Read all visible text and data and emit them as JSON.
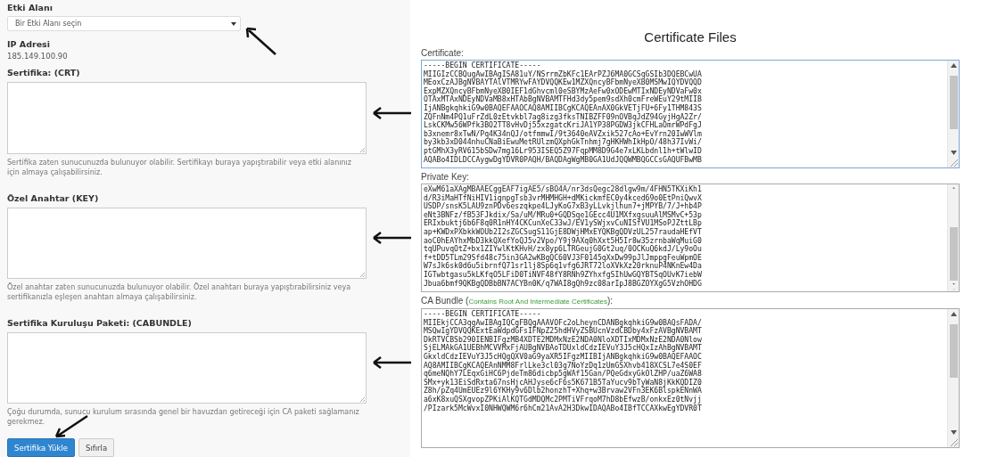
{
  "form": {
    "domain_label": "Etki Alanı",
    "domain_select": {
      "placeholder": "Bir Etki Alanı seçin"
    },
    "ip_label": "IP Adresi",
    "ip_value": "185.149.100.90",
    "fields": [
      {
        "label": "Sertifika: (CRT)",
        "help": "Sertifika zaten sunucunuzda bulunuyor olabilir. Sertifikayı buraya yapıştırabilir veya etki alanınız için almaya çalışabilirsiniz."
      },
      {
        "label": "Özel Anahtar (KEY)",
        "help": "Özel anahtar zaten sunucunuzda bulunuyor olabilir. Özel anahtarı buraya yapıştırabilirsiniz veya sertifikanızla eşleşen anahtarı almaya çalışabilirsiniz."
      },
      {
        "label": "Sertifika Kuruluşu Paketi: (CABUNDLE)",
        "help": "Çoğu durumda, sunucu kurulum sırasında genel bir havuzdan getireceği için CA paketi sağlamanız gerekmez."
      }
    ],
    "buttons": [
      {
        "label": "Sertifika Yükle",
        "kind": "primary"
      },
      {
        "label": "Sıfırla",
        "kind": "secondary"
      }
    ]
  },
  "certificate_files": {
    "title": "Certificate Files",
    "panels": [
      {
        "label": "Certificate:",
        "lines": [
          "-----BEGIN CERTIFICATE-----",
          "MIIGIzCCBQugAwIBAgISA81uY/NSrrmZbKFc1EArPZJ6MA0GCSqGSIb3DQEBCwUA",
          "MEoxCzAJBgNVBAYTAlVTMRYwFAYDVQQKEw1MZXQncyBFbmNyeXB0MSMwIQYDVQQD",
          "ExpMZXQncyBFbmNyeXB0IEF1dGhvcml0eSBYMzAeFw0xODEwMTIxNDEyNDVaFw0x",
          "OTAxMTAxNDEyNDVaMB8xHTAbBgNVBAMTFHd3dy5pem9sdXh0cmFreWEuY29tMIIB",
          "IjANBgkqhkiG9w0BAQEFAAOCAQ8AMIIBCgKCAQEAnAX0GkVETjFU+6Fy1THM843S",
          "ZQFnNm4PQ1uFrZdL0zEtvkbl7ag8izg3fksTNIBZFF09nOVBqJdZ94GyjHgA2Zr/",
          "LskCKMw56WPfk3BO2TT8vHvDj55xzgatcKriJA1YP38PGDW3jkCFHLaOmrWPdFgJ",
          "b3xnemr8xTwN/Pq4K34nQJ/otfmmwI/9t3640eAVZxik527cAo+EvYrn20IwWVlm",
          "by3kb3xD044nhuCNaBiEwuMetRUlzmQXphGkTnhmj7gHKHWhIkHpO/48h37IvWi/",
          "ptGMhX3yRV615bSDw7mg16Lr953ISEQ5Z97FqpMM8D9G4e7xLKLbdnl1h+tWlwID",
          "AQABo4IDLDCCAygwDgYDVR0PAQH/BAQDAgWgMB0GA1UdJQQWMBQGCCsGAQUFBwMB"
        ]
      },
      {
        "label": "Private Key:",
        "lines": [
          "eXwM61aXAgMBAAECggEAF7igAE5/sBO4A/nr3dsQegc28dlgw9m/4FHN5TKXiKh1",
          "d/R3iMaHTfNiHIV1ignpgTsb3vrMHMHGH+dMKickmfEC0y4kced69o0EtPniQwvX",
          "USDP/snsK5LAU9znPDv6eszqkpe4LJyKoG7xB3yLLvkjlhun7+jMPYB/7/J+hb4P",
          "eNt3BNFz/fB53FJkdix/Sa/uM/MRu0+GQDSqe1GEcc4U1MXfxgsuuAlMSMvC+53p",
          "ERIxbuktj6b6F8q0R1nHY4CKCunXeC33wJ/EV1ySWjxvCuNISfVU1MSoPJZttLBp",
          "ap+KWDxPXbkkWOUb2I2sZGCSugS11GjE8DWjHMxEYQKBgQDVzUL257raudaHEfVT",
          "aoC0hEAYhxMbD3kkQXefYoQJ5v2Vpo/Y9j9AXq0hXxt5H5Ir8w35zrnbaWqMuiG0",
          "tqUPuvqOtZ+bx1ZIYwlKtKHvH/zx8yp6LTRGeujG0Gt2uq/0OCKuQ6kdJ/Ly9oOu",
          "f+tDD5TLm29Sfd48c75in3GA2wKBgQC60VJ3F0145qXxDw99pJlJmppgFeuWpmOE",
          "W7sJk6sk0d6u5ibrnfQ71sr1lj8Sp6q1vfg6JRT72loXVkXz20rknuP4NKnEw4Da",
          "IGTwbtgasu5kLKfqO5LFiD0TiNVF48fY8RNh9ZYhxfgSIhUwGQYBTSqOUvK7iebW",
          "Jbua6bmf9QKBgQDBbBN7ACYBn0K/q7WAI8gQh9zc08arIpJ8BGZOYXgG5VzhOHDG"
        ]
      },
      {
        "label": "CA Bundle (",
        "note": "Contains Root And Intermediate Certificates",
        "label_end": "):",
        "lines": [
          "-----BEGIN CERTIFICATE-----",
          "MIIEkjCCA3qgAwIBAgIQCgFBQgAAAVOFc2oLheynCDANBgkqhkiG9w0BAQsFADA/",
          "MSQwIgYDVQQKExtEaWdpdGFsIFNpZ25hdHVyZSBUcnVzdCBDby4xFzAVBgNVBAMT",
          "DkRTVCBSb290IENBIFgzMB4XDTE2MDMxNzE2NDA0NloXDTIxMDMxNzE2NDA0Nlow",
          "SjELMAkGA1UEBhMCVVMxFjAUBgNVBAoTDUxldCdzIEVuY3J5cHQxIzAhBgNVBAMT",
          "GkxldCdzIEVuY3J5cHQgQXV0aG9yaXR5IFgzMIIBIjANBgkqhkiG9w0BAQEFAAOC",
          "AQ8AMIIBCgKCAQEAnNMM8FrlLke3cl03g7NoYzDq1zUmGSXhvb418XCSL7e4S0EF",
          "q6meNQhY7LEqxGiHC6PjdeTm86dicbp5gWAf15Gan/PQeGdxyGkOlZHP/uaZ6WA8",
          "SMx+yk13EiSdRxta67nsHjcAHJyse6cF6s5K671B5TaYucv9bTyWaN8jKkKQDIZ0",
          "Z8h/pZq4UmEUEz9l6YKHy9v6Dlb2honzhT+Xhq+w3Brvaw2VFn3EK6BlspkENnWA",
          "a6xK8xuQSXgvopZPKiAlKQTGdMDQMc2PMTiVFrqoM7hD8bEfwzB/onkxEz0tNvjj",
          "/PIzark5McWvxI0NHWQWM6r6hCm21AvA2H3DkwIDAQABo4IBfTCCAXkwEgYDVR0T"
        ]
      }
    ]
  }
}
